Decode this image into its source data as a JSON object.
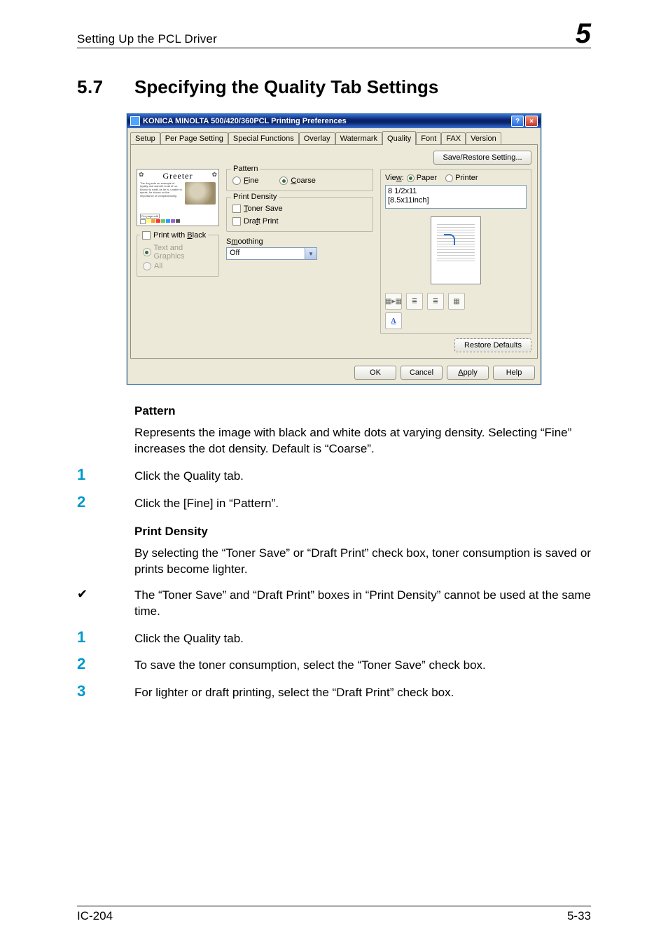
{
  "running_head": {
    "left": "Setting Up the PCL Driver",
    "chapter": "5"
  },
  "section": {
    "number": "5.7",
    "title": "Specifying the Quality Tab Settings"
  },
  "dialog": {
    "title": "KONICA MINOLTA 500/420/360PCL Printing Preferences",
    "help": "?",
    "close": "×",
    "tabs": [
      "Setup",
      "Per Page Setting",
      "Special Functions",
      "Overlay",
      "Watermark",
      "Quality",
      "Font",
      "FAX",
      "Version"
    ],
    "active_tab": "Quality",
    "save_restore": "Save/Restore Setting...",
    "preview": {
      "greeter": "Greeter",
      "corner": "✿",
      "line": "Per page edit",
      "swatches": [
        "#ffffff",
        "#ffff66",
        "#ff9933",
        "#ff3333",
        "#66cc66",
        "#3399ff",
        "#9966cc",
        "#555555"
      ]
    },
    "print_with_black": {
      "label": "Print with Black",
      "text_and_graphics": "Text and Graphics",
      "all": "All"
    },
    "pattern": {
      "legend": "Pattern",
      "fine": "Fine",
      "coarse": "Coarse",
      "selected": "Coarse"
    },
    "print_density": {
      "legend": "Print Density",
      "toner_save": "Toner Save",
      "draft_print": "Draft Print"
    },
    "smoothing": {
      "label": "Smoothing",
      "value": "Off"
    },
    "view": {
      "label": "View:",
      "paper": "Paper",
      "printer": "Printer",
      "selected": "Paper",
      "paper_name": "8 1/2x11\n[8.5x11inch]",
      "a_icon": "A"
    },
    "restore_defaults": "Restore Defaults",
    "buttons": {
      "ok": "OK",
      "cancel": "Cancel",
      "apply": "Apply",
      "help": "Help"
    }
  },
  "sub1": {
    "heading": "Pattern",
    "para": "Represents the image with black and white dots at varying density. Selecting “Fine” increases the dot density. Default is “Coarse”.",
    "step1": "Click the Quality tab.",
    "step2": "Click the [Fine] in “Pattern”."
  },
  "sub2": {
    "heading": "Print Density",
    "para": "By selecting the “Toner Save” or “Draft Print” check box, toner consumption is saved or prints become lighter.",
    "bullet": "The “Toner Save” and “Draft Print” boxes in “Print Density” cannot be used at the same time.",
    "step1": "Click the Quality tab.",
    "step2": "To save the toner consumption, select the “Toner Save” check box.",
    "step3": "For lighter or draft printing, select the “Draft Print” check box."
  },
  "footer": {
    "left": "IC-204",
    "right": "5-33"
  },
  "step_nums": {
    "n1": "1",
    "n2": "2",
    "n3": "3"
  },
  "checkmark": "✔"
}
